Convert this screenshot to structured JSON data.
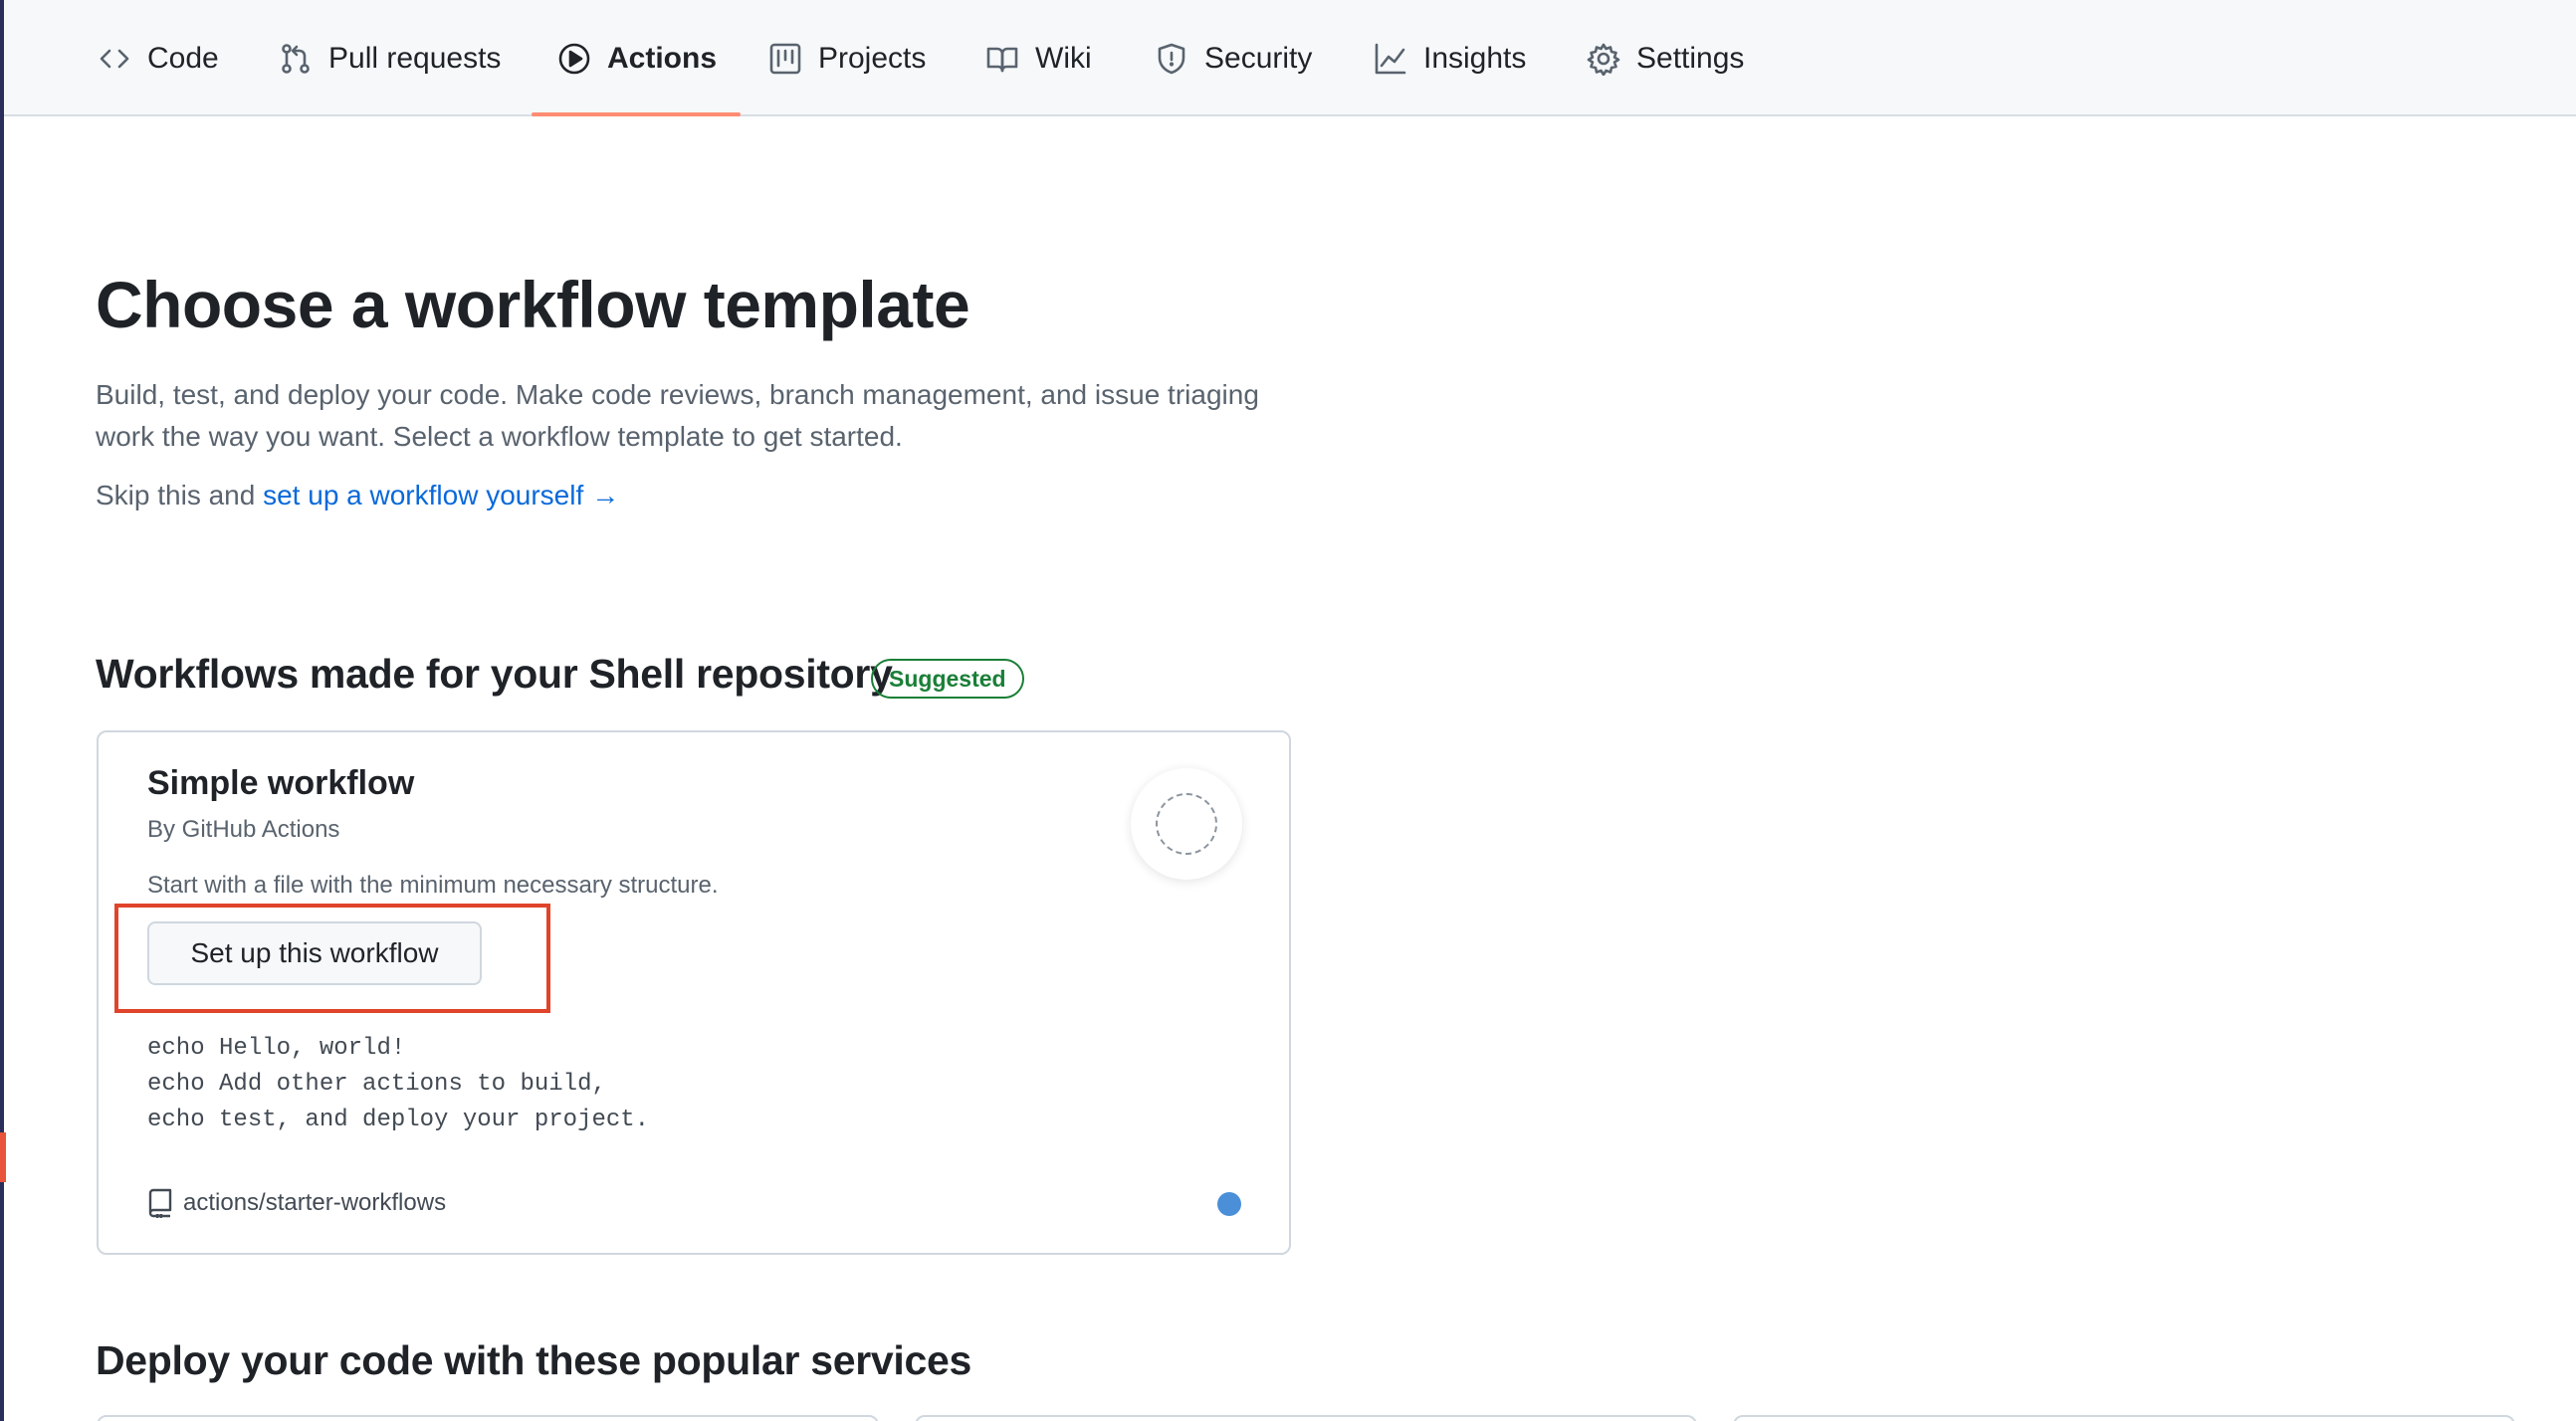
{
  "nav": {
    "items": [
      {
        "label": "Code",
        "icon": "code-icon"
      },
      {
        "label": "Pull requests",
        "icon": "git-pull-request-icon"
      },
      {
        "label": "Actions",
        "icon": "play-icon",
        "active": true
      },
      {
        "label": "Projects",
        "icon": "table-icon"
      },
      {
        "label": "Wiki",
        "icon": "book-icon"
      },
      {
        "label": "Security",
        "icon": "shield-icon"
      },
      {
        "label": "Insights",
        "icon": "graph-icon"
      },
      {
        "label": "Settings",
        "icon": "gear-icon"
      }
    ]
  },
  "header": {
    "title": "Choose a workflow template",
    "description": "Build, test, and deploy your code. Make code reviews, branch management, and issue triaging work the way you want. Select a workflow template to get started.",
    "skip_prefix": "Skip this and",
    "skip_link": "set up a workflow yourself",
    "skip_arrow": "→"
  },
  "suggested": {
    "title": "Workflows made for your Shell repository",
    "badge": "Suggested",
    "card": {
      "title": "Simple workflow",
      "author": "By GitHub Actions",
      "description": "Start with a file with the minimum necessary structure.",
      "button": "Set up this workflow",
      "code": "echo Hello, world!\necho Add other actions to build,\necho test, and deploy your project.",
      "repo": "actions/starter-workflows",
      "language_color": "#4a8fd8"
    }
  },
  "deploy": {
    "title": "Deploy your code with these popular services"
  },
  "colors": {
    "accent_underline": "#fd8c73",
    "link": "#0969da",
    "badge_green": "#1a7f37",
    "highlight": "#e0442a"
  }
}
